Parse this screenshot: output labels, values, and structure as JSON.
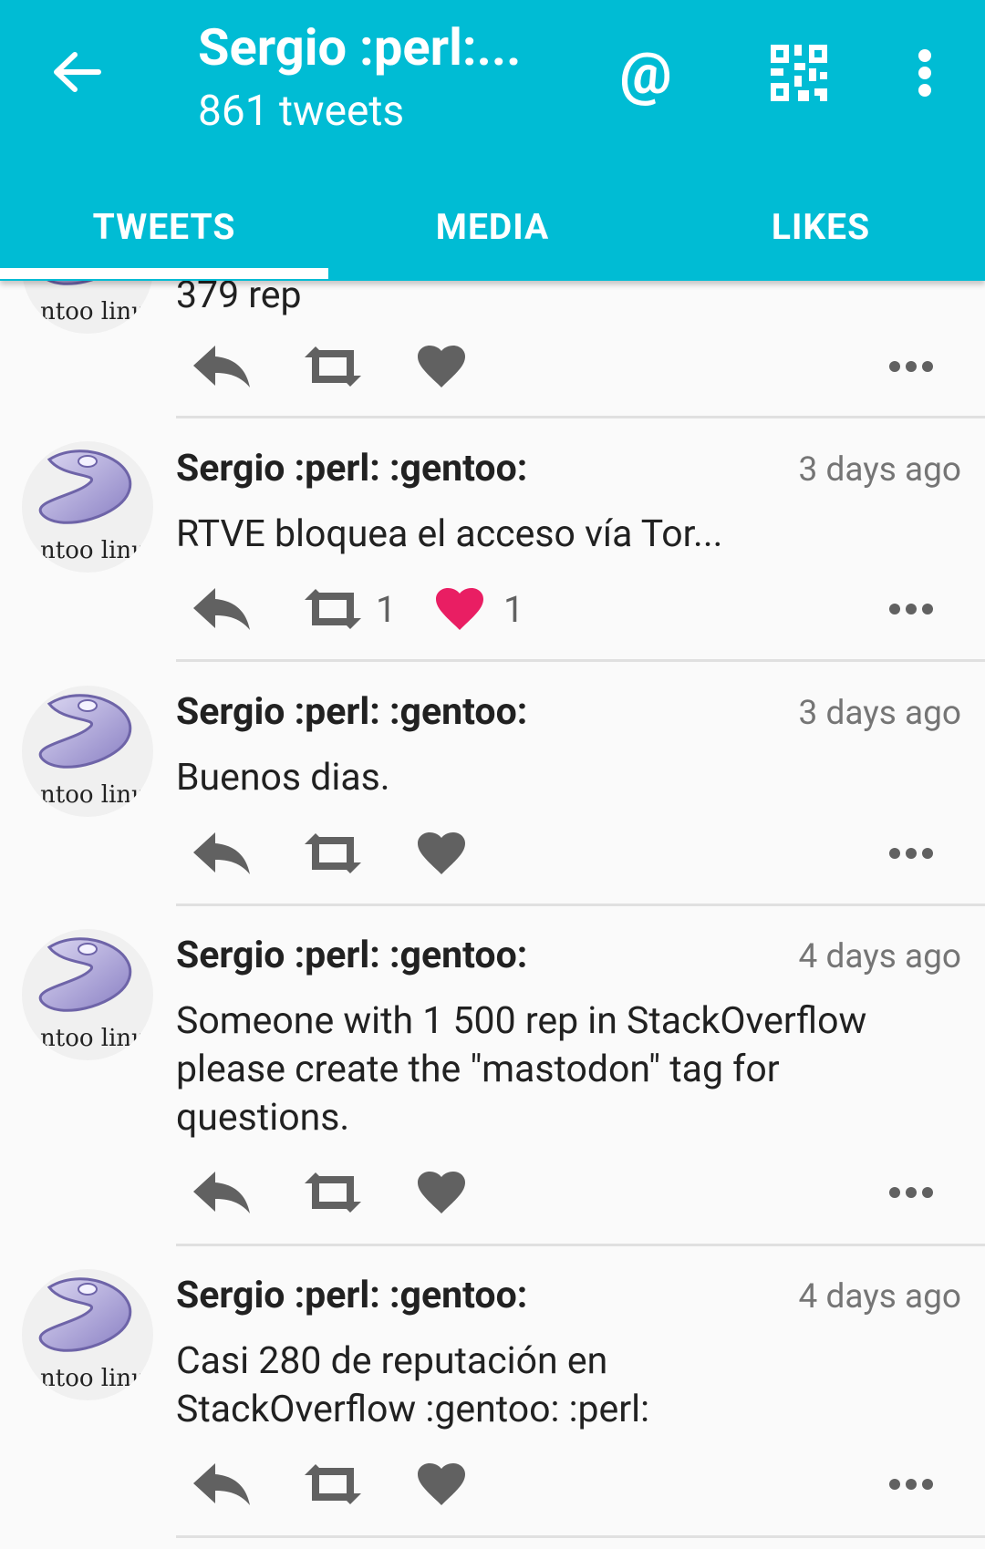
{
  "appbar": {
    "title": "Sergio :perl:...",
    "subtitle": "861 tweets",
    "bg_color": "#00bcd4",
    "icons": {
      "back": "arrow-back-icon",
      "mention": "at-sign-icon",
      "qr": "qr-code-icon",
      "more": "overflow-menu-icon"
    },
    "mention_label": "@"
  },
  "tabs": [
    {
      "label": "TWEETS",
      "selected": true
    },
    {
      "label": "MEDIA",
      "selected": false
    },
    {
      "label": "LIKES",
      "selected": false
    }
  ],
  "partial_tweet": {
    "text": "379 rep"
  },
  "tweets": [
    {
      "author": "Sergio :perl: :gentoo:",
      "time": "3 days ago",
      "text": "RTVE bloquea el acceso vía Tor...",
      "retweets": "1",
      "likes": "1",
      "liked": true
    },
    {
      "author": "Sergio :perl: :gentoo:",
      "time": "3 days ago",
      "text": "Buenos dias.",
      "retweets": "",
      "likes": "",
      "liked": false
    },
    {
      "author": "Sergio :perl: :gentoo:",
      "time": "4 days ago",
      "text": "Someone with 1 500 rep in StackOverflow please create the \"mastodon\" tag for questions.",
      "retweets": "",
      "likes": "",
      "liked": false
    },
    {
      "author": "Sergio :perl: :gentoo:",
      "time": "4 days ago",
      "text": "Casi 280 de reputación en StackOverflow  :gentoo: :perl:",
      "retweets": "",
      "likes": "",
      "liked": false
    }
  ],
  "avatar": {
    "label": "ntoo linu"
  },
  "colors": {
    "like_active": "#e91e63",
    "icon_gray": "#616161"
  }
}
